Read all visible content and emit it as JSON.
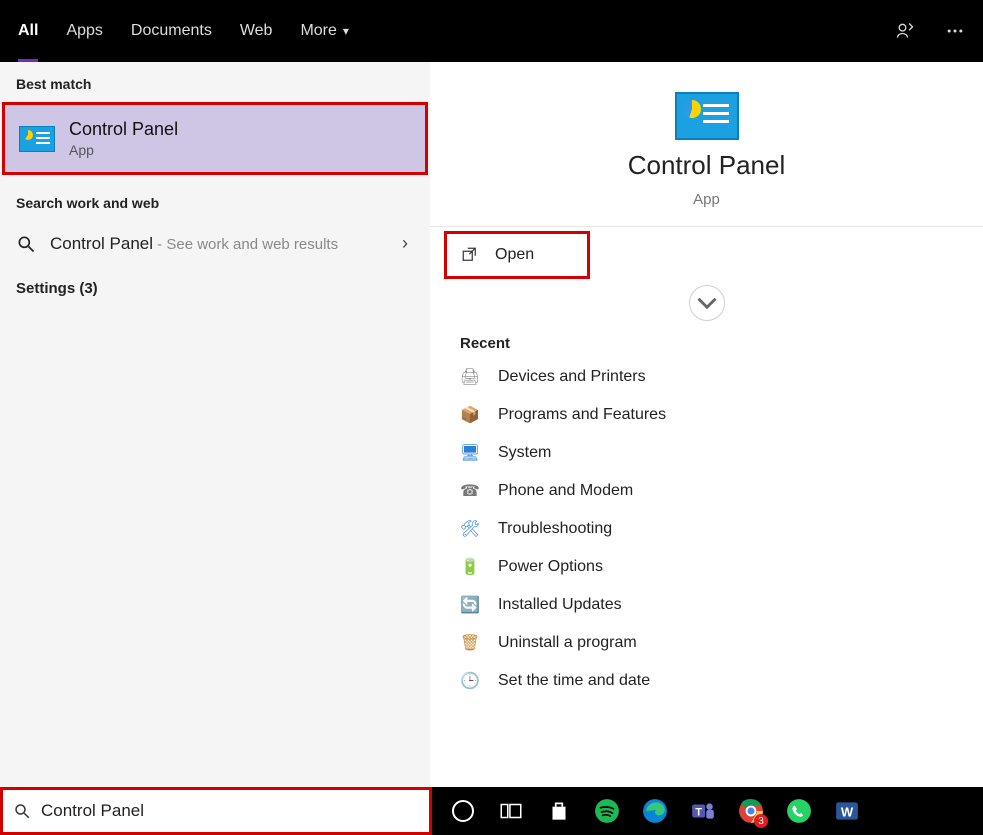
{
  "tabs": {
    "all": "All",
    "apps": "Apps",
    "documents": "Documents",
    "web": "Web",
    "more": "More"
  },
  "sections": {
    "best_match": "Best match",
    "search_work_web": "Search work and web",
    "settings": "Settings (3)",
    "recent": "Recent"
  },
  "best_match": {
    "title": "Control Panel",
    "subtitle": "App"
  },
  "work_web": {
    "title": "Control Panel",
    "subtitle": " - See work and web results"
  },
  "preview": {
    "title": "Control Panel",
    "subtitle": "App",
    "open": "Open"
  },
  "recent_items": [
    "Devices and Printers",
    "Programs and Features",
    "System",
    "Phone and Modem",
    "Troubleshooting",
    "Power Options",
    "Installed Updates",
    "Uninstall a program",
    "Set the time and date"
  ],
  "search_value": "Control Panel",
  "taskbar_badge": "3"
}
